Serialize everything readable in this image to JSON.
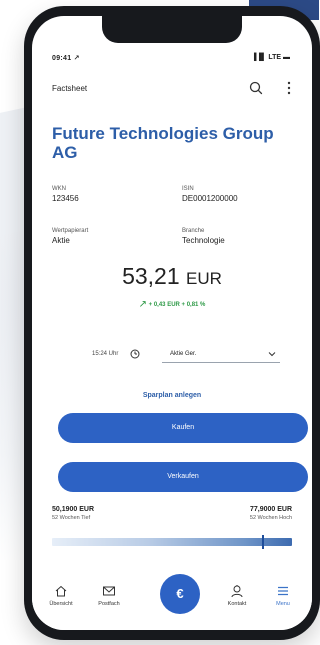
{
  "status_bar": {
    "time": "09:41 ↗",
    "icons": "▐▐▌ LTE ▬"
  },
  "app_bar": {
    "title": "Factsheet",
    "search_icon": "search-icon",
    "more_icon": "more-vertical-icon"
  },
  "company": {
    "name": "Future Technologies Group AG"
  },
  "facts": [
    {
      "label": "WKN",
      "value": "123456"
    },
    {
      "label": "ISIN",
      "value": "DE0001200000"
    },
    {
      "label": "Wertpapierart",
      "value": "Aktie"
    },
    {
      "label": "Branche",
      "value": "Technologie"
    }
  ],
  "quote": {
    "price": "53,21",
    "currency": "EUR",
    "change": "+ 0,43 EUR  + 0,81 %",
    "change_color": "#2e9a47"
  },
  "exchange": {
    "time": "15:24 Uhr",
    "selected": "Aktie Ger.",
    "clock_icon": "clock-icon",
    "chevron_icon": "chevron-down-icon"
  },
  "actions": {
    "savings_plan": "Sparplan anlegen",
    "buy": "Kaufen",
    "sell": "Verkaufen",
    "button_color": "#2d62c4"
  },
  "week52": {
    "low_value": "50,1900 EUR",
    "low_label": "52 Wochen Tief",
    "high_value": "77,9000 EUR",
    "high_label": "52 Wochen Hoch",
    "current_fraction": 0.88
  },
  "bottom_nav": {
    "items": [
      {
        "label": "Übersicht",
        "icon": "home-icon"
      },
      {
        "label": "Postfach",
        "icon": "mail-icon"
      },
      {
        "label": "Kontakt",
        "icon": "contact-icon"
      },
      {
        "label": "Menu",
        "icon": "menu-icon"
      }
    ],
    "fab_label": "€",
    "accent_color": "#3b73c8"
  },
  "colors": {
    "brand_blue": "#2d5ea8",
    "phone_frame": "#17191d"
  }
}
